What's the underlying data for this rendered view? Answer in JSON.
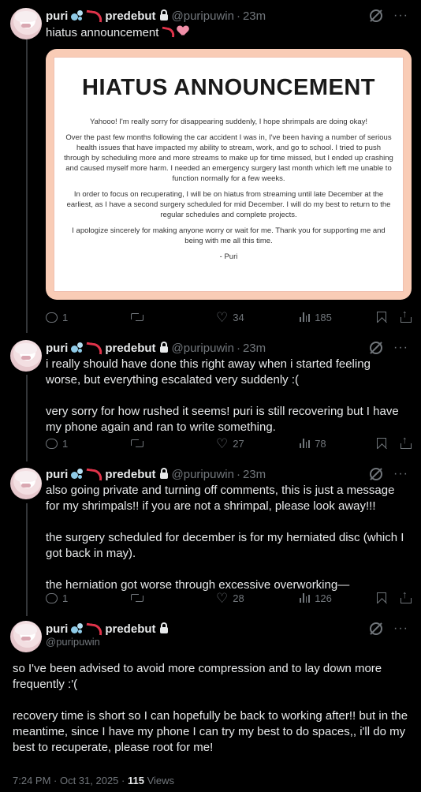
{
  "posts": [
    {
      "display_name": "puri",
      "display_name_suffix": "predebut",
      "handle": "@puripuwin",
      "time": "23m",
      "text": "hiatus announcement",
      "image": {
        "title": "HIATUS ANNOUNCEMENT",
        "paragraphs": [
          "Yahooo! I'm really sorry for disappearing suddenly, I hope shrimpals are doing okay!",
          "Over the past few months following the car accident I was in, I've been having a number of serious health issues that have impacted my ability to stream, work, and go to school. I tried to push through by scheduling more and more streams to make up for time missed, but I ended up crashing and caused myself more harm. I needed an emergency surgery last month which left me unable to function normally for a few weeks.",
          "In order to focus on recuperating, I will be on hiatus from streaming until late December at the earliest, as I have a second surgery scheduled for mid December. I will do my best to return to the regular schedules and complete projects.",
          "I apologize sincerely for making anyone worry or wait for me. Thank you for supporting me and being with me all this time.",
          "- Puri"
        ]
      },
      "replies": "1",
      "likes": "34",
      "views": "185"
    },
    {
      "display_name": "puri",
      "display_name_suffix": "predebut",
      "handle": "@puripuwin",
      "time": "23m",
      "text": "i really should have done this right away when i started feeling worse, but everything escalated very suddenly :(\n\nvery sorry for how rushed it seems! puri is still recovering but I have my phone again and ran to write something.",
      "replies": "1",
      "likes": "27",
      "views": "78"
    },
    {
      "display_name": "puri",
      "display_name_suffix": "predebut",
      "handle": "@puripuwin",
      "time": "23m",
      "text": "also going private and turning off comments, this is just a message for my shrimpals!! if you are not a shrimpal, please look away!!!\n\nthe surgery scheduled for december is for my herniated disc (which I got back in may).\n\nthe herniation got worse through excessive overworking—",
      "replies": "1",
      "likes": "28",
      "views": "126"
    }
  ],
  "main_post": {
    "display_name": "puri",
    "display_name_suffix": "predebut",
    "handle": "@puripuwin",
    "text": "so I've been advised to avoid more compression and to lay down more frequently :'(\n\nrecovery time is short so I can hopefully be back to working after!! but in the meantime, since I have my phone I can try my best to do spaces,, i'll do my best to recuperate, please root for me!",
    "timestamp": "7:24 PM · Oct 31, 2025 · ",
    "views_count": "115",
    "views_label": "Views"
  },
  "separator": "·",
  "icons": {
    "grok": "grok-icon",
    "more": "more-icon",
    "reply": "reply-icon",
    "retweet": "retweet-icon",
    "like": "heart-icon",
    "views": "views-icon",
    "bookmark": "bookmark-icon",
    "share": "share-icon"
  },
  "colors": {
    "background": "#000000",
    "text": "#e7e9ea",
    "muted": "#71767b",
    "image_border": "#f9ccb6"
  }
}
